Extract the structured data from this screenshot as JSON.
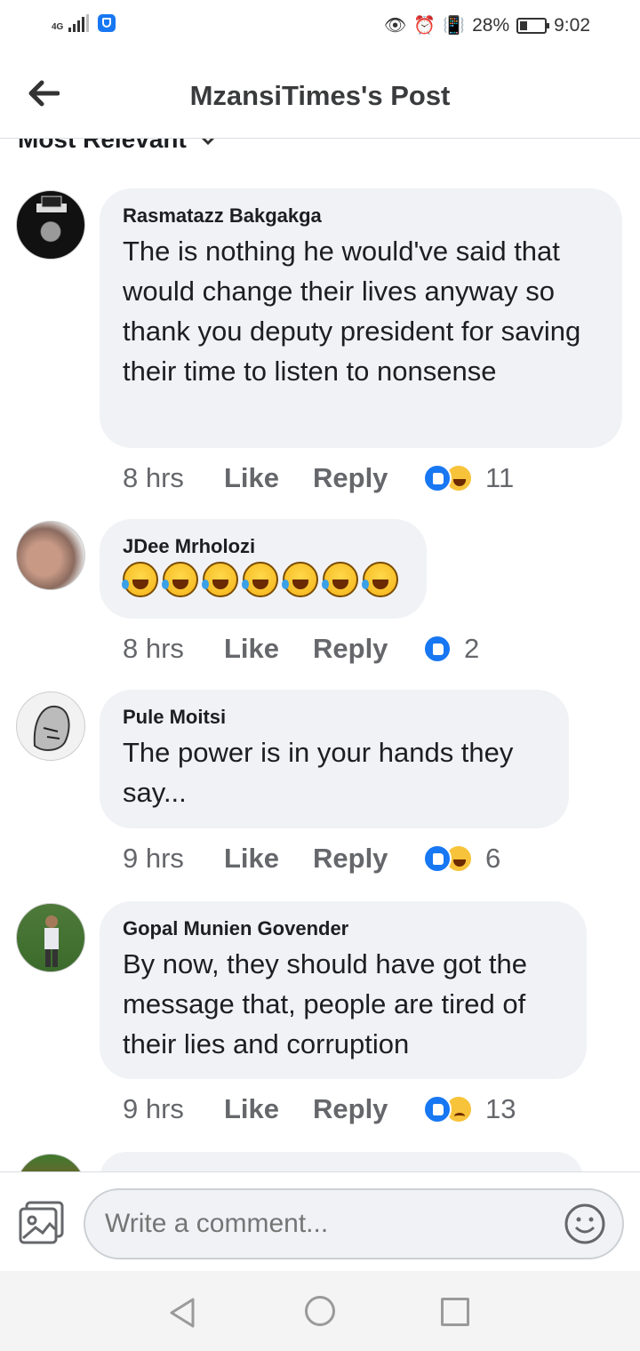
{
  "status_bar": {
    "network": "4G",
    "battery": "28%",
    "time": "9:02"
  },
  "header": {
    "title": "MzansiTimes's Post"
  },
  "sort": {
    "label": "Most Relevant"
  },
  "comments": [
    {
      "author": "Rasmatazz Bakgakga",
      "text": "The is nothing he would've said that would change their lives anyway so thank you deputy president for saving their time to listen to nonsense",
      "time": "8 hrs",
      "like_label": "Like",
      "reply_label": "Reply",
      "reactions": [
        "like-icon",
        "haha-icon"
      ],
      "count": "11"
    },
    {
      "author": "JDee Mrholozi",
      "text": "",
      "emoji_count": 7,
      "emoji": "laughing-tears-emoji",
      "time": "8 hrs",
      "like_label": "Like",
      "reply_label": "Reply",
      "reactions": [
        "like-icon"
      ],
      "count": "2"
    },
    {
      "author": "Pule Moitsi",
      "text": "The power is in your hands they say...",
      "time": "9 hrs",
      "like_label": "Like",
      "reply_label": "Reply",
      "reactions": [
        "like-icon",
        "haha-icon"
      ],
      "count": "6"
    },
    {
      "author": "Gopal Munien Govender",
      "text": "By now, they should have got the message that, people are tired of their lies and corruption",
      "time": "9 hrs",
      "like_label": "Like",
      "reply_label": "Reply",
      "reactions": [
        "like-icon",
        "sad-icon"
      ],
      "count": "13"
    }
  ],
  "composer": {
    "placeholder": "Write a comment..."
  },
  "colors": {
    "accent": "#1877f2",
    "bubble": "#f0f2f5",
    "muted_text": "#65676b"
  }
}
